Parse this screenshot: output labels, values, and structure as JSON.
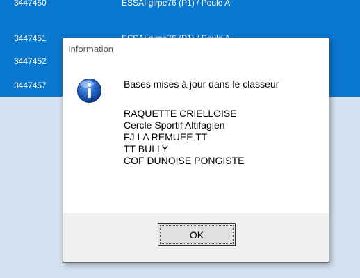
{
  "list": {
    "rows": [
      {
        "id": "3447450",
        "text": "ESSAI girpe76 (P1) / Poule A"
      },
      {
        "id": "3447451",
        "text": "ESSAI girpe76 (P1) / Poule A"
      },
      {
        "id": "3447452",
        "text": ""
      },
      {
        "id": "3447457",
        "text": ""
      }
    ]
  },
  "dialog": {
    "title": "Information",
    "icon": "info-icon",
    "message": "Bases mises à jour dans le classeur",
    "clubs": [
      "RAQUETTE CRIELLOISE",
      "Cercle Sportif Altifagien",
      "FJ LA REMUEE TT",
      "TT BULLY",
      "COF DUNOISE PONGISTE"
    ],
    "ok_label": "OK"
  },
  "colors": {
    "list_selection": "#0b78d0",
    "background": "#d4e1f0",
    "dialog_bg": "#f0f0f0",
    "info_icon": "#1f5fbf"
  }
}
